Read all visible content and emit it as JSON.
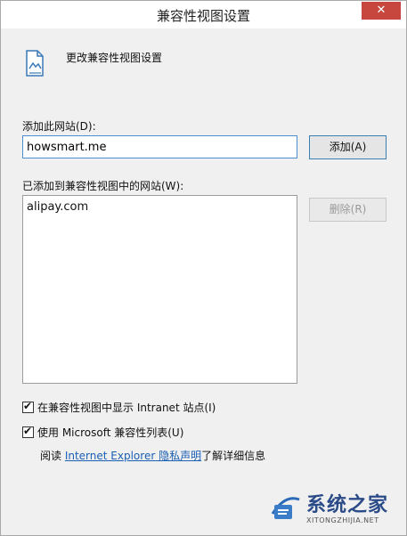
{
  "window": {
    "title": "兼容性视图设置",
    "close_label": "✕"
  },
  "header": {
    "icon": "compat-view-icon",
    "text": "更改兼容性视图设置"
  },
  "add_site": {
    "label": "添加此网站(D):",
    "value": "howsmart.me",
    "button_label": "添加(A)"
  },
  "site_list": {
    "label": "已添加到兼容性视图中的网站(W):",
    "items": [
      "alipay.com"
    ],
    "remove_label": "删除(R)"
  },
  "options": {
    "show_intranet": {
      "label": "在兼容性视图中显示 Intranet 站点(I)",
      "checked": true
    },
    "use_ms_list": {
      "label": "使用 Microsoft 兼容性列表(U)",
      "checked": true
    }
  },
  "read_more": {
    "prefix": "阅读 ",
    "link": "Internet Explorer 隐私声明",
    "suffix": "了解详细信息"
  },
  "watermark": {
    "title": "系统之家",
    "subtitle": "XITONGZHIJIA.NET"
  },
  "colors": {
    "close": "#c7473e",
    "link": "#1a5fb4",
    "focus_border": "#4d8fd1"
  }
}
